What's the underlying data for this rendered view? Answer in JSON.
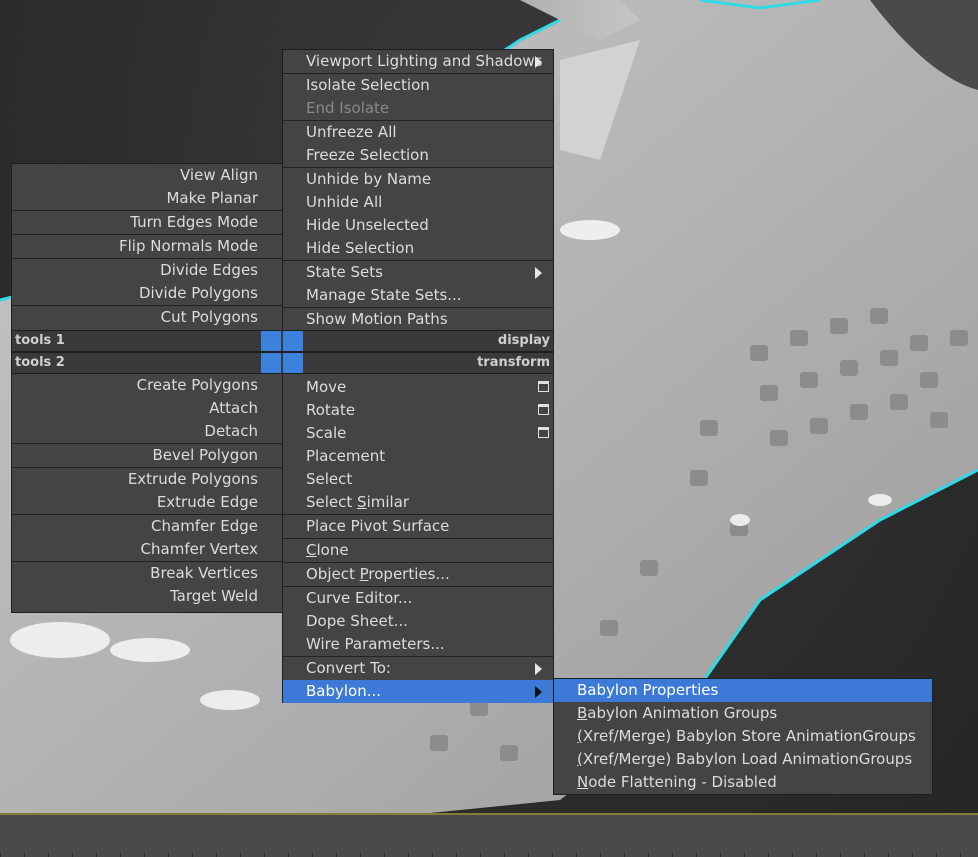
{
  "colors": {
    "menu_bg": "#444444",
    "highlight": "#3d7ad8",
    "quad_square": "#3c82dc",
    "outline": "#2fd9e6",
    "mesh": "#b8b8b8"
  },
  "left_quad": {
    "groups": [
      [
        "View Align",
        "Make Planar"
      ],
      [
        "Turn Edges Mode"
      ],
      [
        "Flip Normals Mode"
      ],
      [
        "Divide Edges",
        "Divide Polygons"
      ],
      [
        "Cut Polygons"
      ]
    ],
    "groups_lower": [
      [
        "Create Polygons",
        "Attach",
        "Detach"
      ],
      [
        "Bevel Polygon"
      ],
      [
        "Extrude Polygons",
        "Extrude Edge"
      ],
      [
        "Chamfer Edge",
        "Chamfer Vertex"
      ],
      [
        "Break Vertices",
        "Target Weld"
      ]
    ]
  },
  "quad_labels": {
    "tools1": "tools 1",
    "tools2": "tools 2",
    "display": "display",
    "transform": "transform"
  },
  "right_quad": {
    "display_items": {
      "viewport_lighting": "Viewport Lighting and Shadows",
      "isolate_selection": "Isolate Selection",
      "end_isolate": "End Isolate",
      "unfreeze_all": "Unfreeze All",
      "freeze_selection": "Freeze Selection",
      "unhide_by_name": "Unhide by Name",
      "unhide_all": "Unhide All",
      "hide_unselected": "Hide Unselected",
      "hide_selection": "Hide Selection",
      "state_sets": "State Sets",
      "manage_state_sets": "Manage State Sets...",
      "show_motion_paths": "Show Motion Paths"
    },
    "transform_items": {
      "move": "Move",
      "rotate": "Rotate",
      "scale": "Scale",
      "placement": "Placement",
      "select": "Select",
      "select_similar_pre": "Select ",
      "select_similar_u": "S",
      "select_similar_post": "imilar",
      "place_pivot_surface": "Place Pivot Surface",
      "clone_u": "C",
      "clone_post": "lone",
      "object_properties_pre": "Object ",
      "object_properties_u": "P",
      "object_properties_post": "roperties...",
      "curve_editor": "Curve Editor...",
      "dope_sheet": "Dope Sheet...",
      "wire_parameters": "Wire Parameters...",
      "convert_to": "Convert To:",
      "babylon": "Babylon..."
    }
  },
  "submenu": {
    "babylon_properties": "Babylon Properties",
    "animation_groups_u": "B",
    "animation_groups_post": "abylon Animation Groups",
    "store_pre": "",
    "store_u": "(",
    "store_post": "Xref/Merge) Babylon Store AnimationGroups",
    "load_u": "(",
    "load_post": "Xref/Merge) Babylon Load AnimationGroups",
    "flattening_u": "N",
    "flattening_post": "ode Flattening - Disabled"
  }
}
